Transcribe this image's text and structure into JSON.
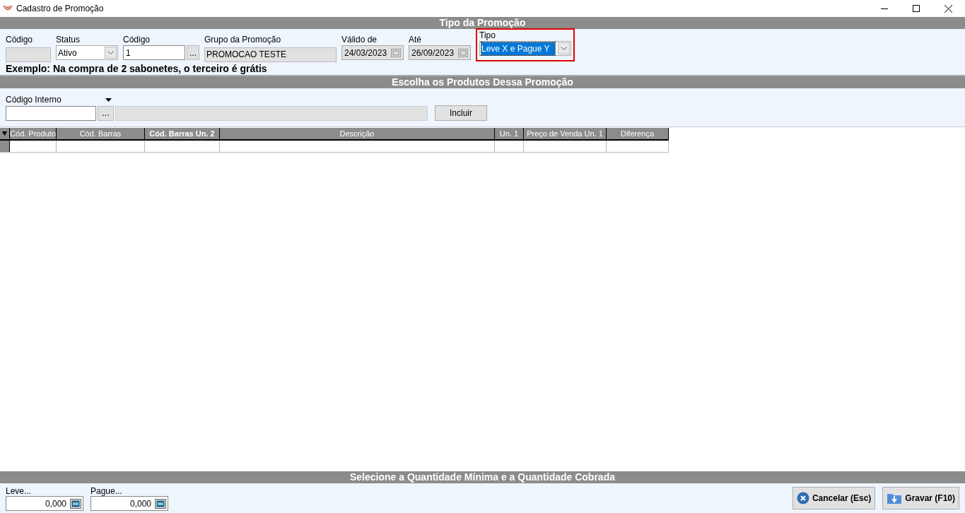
{
  "window": {
    "title": "Cadastro de Promoção"
  },
  "promo_type": {
    "heading": "Tipo da Promoção",
    "fields": [
      {
        "kind": "text",
        "label": "Código",
        "disabled": true
      },
      {
        "kind": "select",
        "label": "Status",
        "value": "Ativo",
        "disabled": false
      },
      {
        "kind": "lookup",
        "label": "Código",
        "value": "1",
        "button": "...",
        "disabled": false
      },
      {
        "kind": "text",
        "label": "Grupo da Promoção",
        "value": "PROMOCAO TESTE",
        "disabled": true
      },
      {
        "kind": "date",
        "label": "Válido de",
        "value": "24/03/2023",
        "disabled": true
      },
      {
        "kind": "date",
        "label": "Até",
        "value": "26/09/2023",
        "disabled": true
      },
      {
        "kind": "select",
        "label": "Tipo",
        "value": "Leve X e Pague Y",
        "disabled": false,
        "focused": true
      }
    ],
    "example": "Exemplo: Na compra de 2 sabonetes, o terceiro é grátis"
  },
  "products": {
    "heading": "Escolha os Produtos Dessa Promoção",
    "search_label": "Código Interno",
    "lookup_button": "...",
    "add_button": "Incluir"
  },
  "table": {
    "columns": [
      {
        "label": "Cód. Produto",
        "bold": false
      },
      {
        "label": "Cód. Barras",
        "bold": false
      },
      {
        "label": "Cód. Barras Un. 2",
        "bold": true
      },
      {
        "label": "Descrição",
        "bold": false
      },
      {
        "label": "Un. 1",
        "bold": false
      },
      {
        "label": "Preço de Venda Un. 1",
        "bold": false
      },
      {
        "label": "Diferença",
        "bold": false
      }
    ]
  },
  "quantities": {
    "heading": "Selecione a Quantidade Mínima e a Quantidade Cobrada",
    "fields": [
      {
        "label": "Leve...",
        "value": "0,000"
      },
      {
        "label": "Pague...",
        "value": "0,000"
      }
    ]
  },
  "buttons": [
    {
      "kind": "cancel",
      "label": "Cancelar (Esc)"
    },
    {
      "kind": "save",
      "label": "Gravar (F10)"
    }
  ]
}
